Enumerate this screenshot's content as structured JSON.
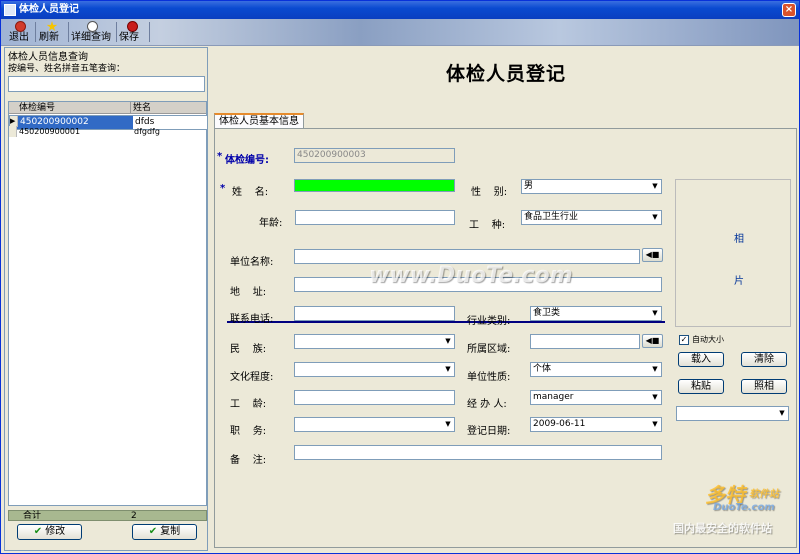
{
  "window": {
    "title": "体检人员登记"
  },
  "toolbar": {
    "exit": "退出",
    "refresh": "刷新",
    "detail_query": "详细查询",
    "save": "保存"
  },
  "left_panel": {
    "title": "体检人员信息查询",
    "hint": "按编号、姓名拼音五笔查询：",
    "search_value": "",
    "columns": [
      "体检编号",
      "姓名"
    ],
    "rows": [
      {
        "id": "450200900002",
        "name": "dfds"
      },
      {
        "id": "450200900001",
        "name": "dfgdfg"
      }
    ],
    "footer": {
      "label": "合计",
      "count": "2"
    },
    "modify_button": "修改",
    "copy_button": "复制"
  },
  "form": {
    "heading": "体检人员登记",
    "tab_label": "体检人员基本信息",
    "labels": {
      "id": "体检编号:",
      "name": "姓    名:",
      "gender": "性    别:",
      "age": "年龄:",
      "work_type": "工    种:",
      "company": "单位名称:",
      "address": "地    址:",
      "phone": "联系电话:",
      "industry": "行业类别:",
      "ethnicity": "民    族:",
      "region": "所属区域:",
      "education": "文化程度:",
      "company_nature": "单位性质:",
      "seniority": "工    龄:",
      "handler": "经 办 人:",
      "position": "职    务:",
      "reg_date": "登记日期:",
      "notes": "备    注:"
    },
    "values": {
      "id": "450200900003",
      "name": "",
      "gender": "男",
      "age": "",
      "work_type": "食品卫生行业",
      "company": "",
      "address": "",
      "phone": "",
      "industry": "食卫类",
      "ethnicity": "",
      "region": "",
      "education": "",
      "company_nature": "个体",
      "seniority": "",
      "handler": "manager",
      "position": "",
      "reg_date": "2009-06-11",
      "notes": ""
    },
    "photo": {
      "label_top": "相",
      "label_bottom": "片",
      "auto_size": "自动大小",
      "load": "载入",
      "clear": "清除",
      "paste": "粘贴",
      "camera": "照相",
      "device": ""
    }
  },
  "watermark": {
    "text": "www.DuoTe.com",
    "logo_cn": "多特",
    "logo_suffix": "软件站",
    "logo_en": "DuoTe.com",
    "slogan": "国内最安全的软件站"
  },
  "colors": {
    "title_bar": "#0a4ad0",
    "selection": "#316ac5",
    "name_field": "#00ff00",
    "required_mark": "#0000aa"
  }
}
